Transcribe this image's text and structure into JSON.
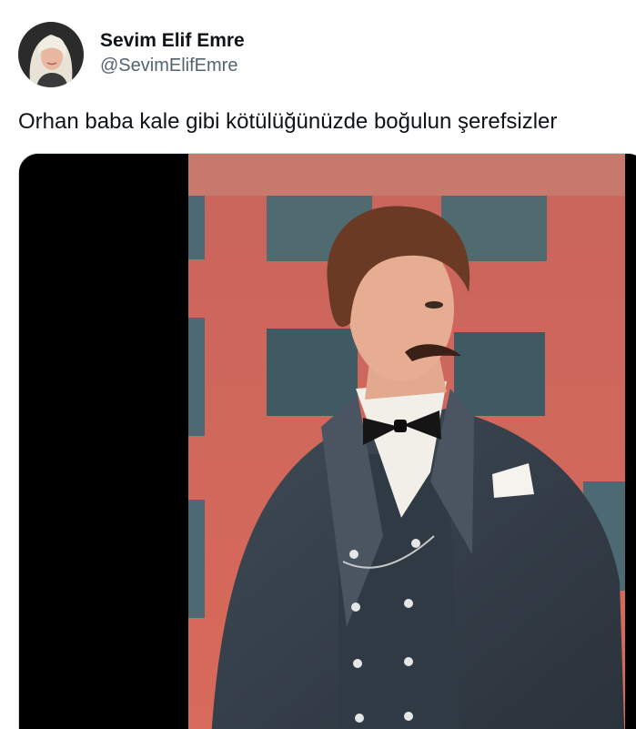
{
  "author": {
    "display_name": "Sevim Elif Emre",
    "handle": "@SevimElifEmre",
    "avatar_icon": "profile-photo"
  },
  "tweet": {
    "text": "Orhan baba kale gibi kötülüğünüzde boğulun şerefsizler"
  },
  "media": {
    "type": "photo",
    "subject": "man in dark three-piece suit with bow tie in front of red brick building"
  },
  "colors": {
    "text_primary": "#0f1419",
    "text_secondary": "#536471",
    "border": "#cfd9de",
    "letterbox": "#000000"
  }
}
